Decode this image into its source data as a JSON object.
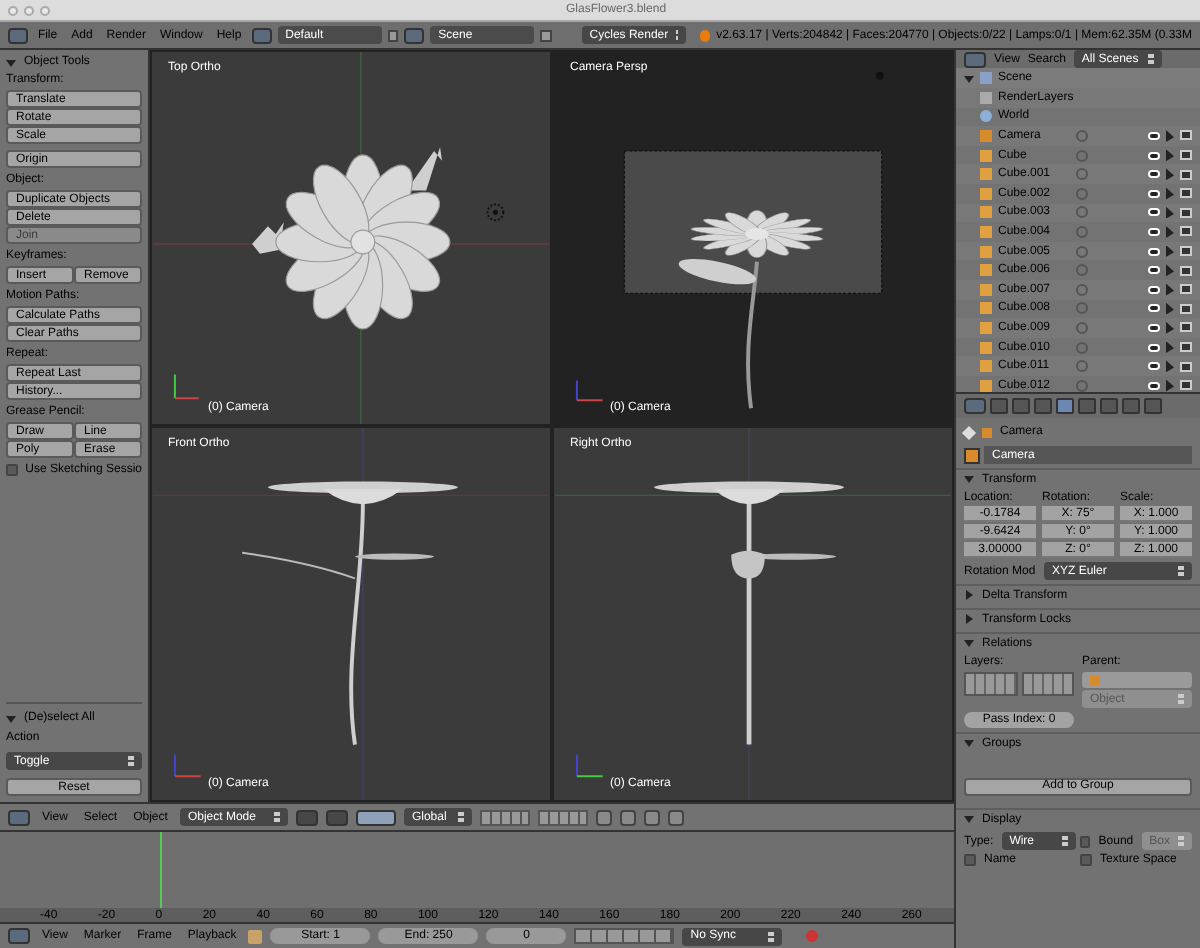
{
  "window": {
    "title": "GlasFlower3.blend"
  },
  "info_header": {
    "menus": [
      "File",
      "Add",
      "Render",
      "Window",
      "Help"
    ],
    "layout": "Default",
    "scene": "Scene",
    "engine": "Cycles Render",
    "stats": "v2.63.17 | Verts:204842 | Faces:204770 | Objects:0/22 | Lamps:0/1 | Mem:62.35M (0.33M"
  },
  "tool_shelf": {
    "title": "Object Tools",
    "sections": [
      {
        "label": "Transform:",
        "kind": "stack",
        "buttons": [
          {
            "label": "Translate",
            "disabled": false
          },
          {
            "label": "Rotate",
            "disabled": false
          },
          {
            "label": "Scale",
            "disabled": false
          }
        ]
      },
      {
        "kind": "stack",
        "buttons": [
          {
            "label": "Origin",
            "disabled": false
          }
        ]
      },
      {
        "label": "Object:",
        "kind": "stack",
        "buttons": [
          {
            "label": "Duplicate Objects",
            "disabled": false
          },
          {
            "label": "Delete",
            "disabled": false
          },
          {
            "label": "Join",
            "disabled": true
          }
        ]
      },
      {
        "label": "Keyframes:",
        "kind": "grid",
        "buttons": [
          {
            "label": "Insert",
            "disabled": false
          },
          {
            "label": "Remove",
            "disabled": false
          }
        ]
      },
      {
        "label": "Motion Paths:",
        "kind": "stack",
        "buttons": [
          {
            "label": "Calculate Paths",
            "disabled": false
          },
          {
            "label": "Clear Paths",
            "disabled": false
          }
        ]
      },
      {
        "label": "Repeat:",
        "kind": "stack",
        "buttons": [
          {
            "label": "Repeat Last",
            "disabled": false
          },
          {
            "label": "History...",
            "disabled": false
          }
        ]
      },
      {
        "label": "Grease Pencil:",
        "kind": "grid",
        "buttons": [
          {
            "label": "Draw",
            "disabled": false
          },
          {
            "label": "Line",
            "disabled": false
          },
          {
            "label": "Poly",
            "disabled": false
          },
          {
            "label": "Erase",
            "disabled": false
          }
        ]
      }
    ],
    "sketching": {
      "label": "Use Sketching Sessio",
      "checked": false
    },
    "operator": {
      "title": "(De)select All",
      "expanded": true,
      "action_label": "Action",
      "action": "Toggle",
      "reset": "Reset"
    }
  },
  "viewports": [
    {
      "label": "Top Ortho",
      "object": "(0) Camera",
      "kind": "top"
    },
    {
      "label": "Camera Persp",
      "object": "(0) Camera",
      "kind": "camera"
    },
    {
      "label": "Front Ortho",
      "object": "(0) Camera",
      "kind": "front"
    },
    {
      "label": "Right Ortho",
      "object": "(0) Camera",
      "kind": "right"
    }
  ],
  "view3d_header": {
    "menus": [
      "View",
      "Select",
      "Object"
    ],
    "mode": "Object Mode",
    "orientation": "Global"
  },
  "timeline": {
    "ruler": [
      "-40",
      "-20",
      "0",
      "20",
      "40",
      "60",
      "80",
      "100",
      "120",
      "140",
      "160",
      "180",
      "200",
      "220",
      "240",
      "260"
    ],
    "menus": [
      "View",
      "Marker",
      "Frame",
      "Playback"
    ],
    "start": "Start: 1",
    "end": "End: 250",
    "frame": "0",
    "sync": "No Sync"
  },
  "outliner": {
    "menus": [
      "View",
      "Search"
    ],
    "filter": "All Scenes",
    "tree": [
      {
        "name": "Scene",
        "kind": "scene",
        "expanded": true,
        "children": [
          {
            "name": "RenderLayers",
            "kind": "renderlayers"
          },
          {
            "name": "World",
            "kind": "world"
          },
          {
            "name": "Camera",
            "kind": "camera"
          },
          {
            "name": "Cube",
            "kind": "mesh"
          },
          {
            "name": "Cube.001",
            "kind": "mesh"
          },
          {
            "name": "Cube.002",
            "kind": "mesh"
          },
          {
            "name": "Cube.003",
            "kind": "mesh"
          },
          {
            "name": "Cube.004",
            "kind": "mesh"
          },
          {
            "name": "Cube.005",
            "kind": "mesh"
          },
          {
            "name": "Cube.006",
            "kind": "mesh"
          },
          {
            "name": "Cube.007",
            "kind": "mesh"
          },
          {
            "name": "Cube.008",
            "kind": "mesh"
          },
          {
            "name": "Cube.009",
            "kind": "mesh"
          },
          {
            "name": "Cube.010",
            "kind": "mesh"
          },
          {
            "name": "Cube.011",
            "kind": "mesh"
          },
          {
            "name": "Cube.012",
            "kind": "mesh"
          }
        ]
      }
    ]
  },
  "properties": {
    "tabs": [
      {
        "selected": false
      },
      {
        "selected": false
      },
      {
        "selected": false
      },
      {
        "selected": true
      },
      {
        "selected": false
      },
      {
        "selected": false
      },
      {
        "selected": false
      },
      {
        "selected": false
      }
    ],
    "context": "Camera",
    "object_name": "Camera",
    "transform": {
      "title": "Transform",
      "expanded": true,
      "location_label": "Location:",
      "rotation_label": "Rotation:",
      "scale_label": "Scale:",
      "location": [
        "-0.1784",
        "-9.6424",
        "3.00000"
      ],
      "rotation": [
        "X: 75°",
        "Y: 0°",
        "Z: 0°"
      ],
      "scale": [
        "X: 1.000",
        "Y: 1.000",
        "Z: 1.000"
      ],
      "rotation_mode_label": "Rotation Mod",
      "rotation_mode": "XYZ Euler"
    },
    "collapsed_panels": [
      {
        "title": "Delta Transform",
        "expanded": false
      },
      {
        "title": "Transform Locks",
        "expanded": false
      }
    ],
    "relations": {
      "title": "Relations",
      "expanded": true,
      "layers_label": "Layers:",
      "parent_label": "Parent:",
      "parent_type": "Object",
      "pass_index": "Pass Index: 0"
    },
    "groups": {
      "title": "Groups",
      "expanded": true,
      "button": "Add to Group"
    },
    "display": {
      "title": "Display",
      "expanded": true,
      "type_label": "Type:",
      "type": "Wire",
      "bound": {
        "label": "Bound",
        "checked": false
      },
      "bound_type": "Box",
      "name": {
        "label": "Name",
        "checked": false
      },
      "texture_space": {
        "label": "Texture Space",
        "checked": false
      }
    }
  }
}
